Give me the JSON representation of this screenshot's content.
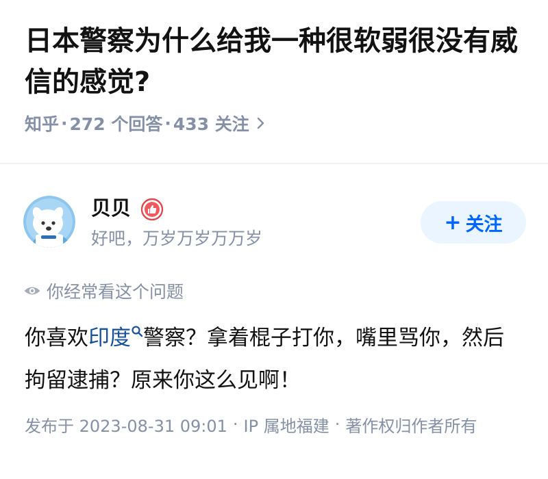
{
  "question": {
    "title": "日本警察为什么给我一种很软弱很没有威信的感觉?",
    "source": "知乎",
    "separator": "·",
    "answer_count": "272 个回答",
    "follower_count": "433 关注",
    "chevron_icon": "chevron-right-icon"
  },
  "answer": {
    "author": {
      "name": "贝贝",
      "bio": "好吧，万岁万岁万万岁",
      "avatar_icon": "dog-avatar",
      "badge_icon": "thumbs-up-badge-icon"
    },
    "follow_button": {
      "plus": "+",
      "label": "关注"
    },
    "viewed_hint": {
      "icon": "eye-icon",
      "text": "你经常看这个问题"
    },
    "content": {
      "part1": "你喜欢",
      "keyword": "印度",
      "keyword_icon": "search-icon",
      "part2": "警察？拿着棍子打你，嘴里骂你，然后拘留逮捕？原来你这么见啊！"
    },
    "footer": {
      "published": "发布于 2023-08-31 09:01",
      "ip": "IP 属地福建",
      "copyright": "著作权归作者所有",
      "dot": "·"
    }
  },
  "colors": {
    "title": "#121212",
    "meta": "#8590a6",
    "link": "#175199",
    "follow_bg": "#ebf5ff",
    "follow_text": "#0066ff",
    "divider": "#f0f1f3"
  }
}
